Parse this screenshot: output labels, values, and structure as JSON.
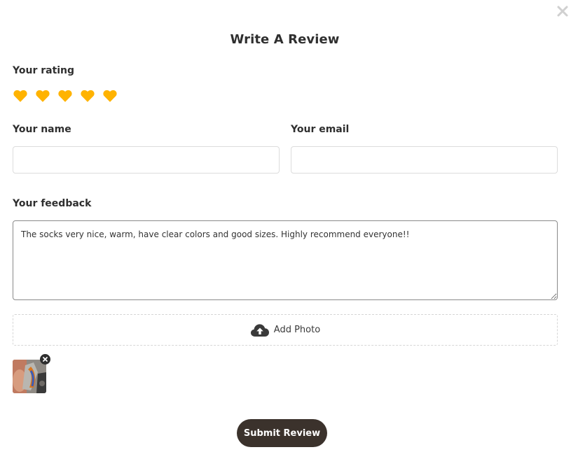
{
  "modal": {
    "title": "Write A Review",
    "close_icon": "close-icon"
  },
  "rating": {
    "label": "Your rating",
    "value": 5,
    "max": 5,
    "icon": "heart-icon",
    "color": "#ffb300"
  },
  "name": {
    "label": "Your name",
    "value": "",
    "placeholder": ""
  },
  "email": {
    "label": "Your email",
    "value": "",
    "placeholder": ""
  },
  "feedback": {
    "label": "Your feedback",
    "value": "The socks very nice, warm, have clear colors and good sizes. Highly recommend everyone!!"
  },
  "photo": {
    "add_label": "Add Photo",
    "icon": "cloud-upload-icon",
    "remove_icon": "remove-photo-icon"
  },
  "submit": {
    "label": "Submit Review",
    "color": "#3b322c"
  }
}
